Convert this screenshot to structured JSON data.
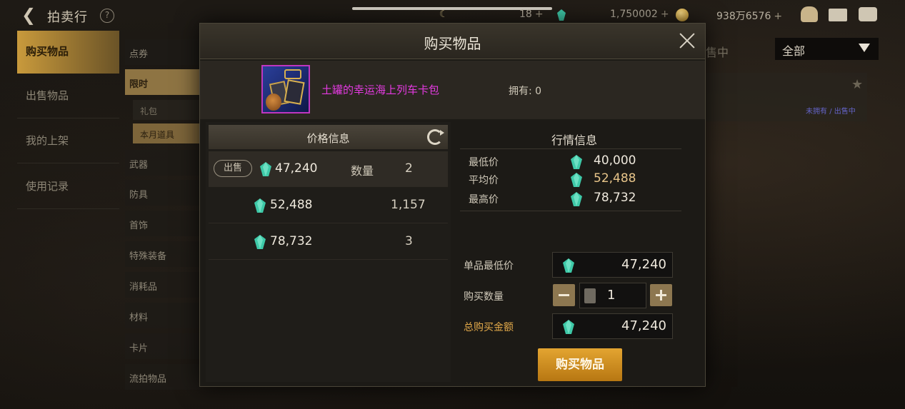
{
  "top_bar": {
    "title": "拍卖行",
    "help": "?",
    "moon": "☾",
    "currency1": "18",
    "currency2": "1,750002",
    "currency3": "938万6576",
    "plus": "+"
  },
  "nav": {
    "items": [
      {
        "label": "购买物品"
      },
      {
        "label": "出售物品"
      },
      {
        "label": "我的上架"
      },
      {
        "label": "使用记录"
      }
    ]
  },
  "categories": {
    "items": [
      {
        "label": "点券"
      },
      {
        "label": "限时"
      },
      {
        "label": "武器"
      },
      {
        "label": "防具"
      },
      {
        "label": "首饰"
      },
      {
        "label": "特殊装备"
      },
      {
        "label": "消耗品"
      },
      {
        "label": "材料"
      },
      {
        "label": "卡片"
      },
      {
        "label": "流拍物品"
      }
    ],
    "subitems": [
      {
        "label": "礼包"
      },
      {
        "label": "本月道具"
      }
    ]
  },
  "right_filter": {
    "value": "全部",
    "behind_label": "售中",
    "link_left": "未拥有",
    "link_sep": "/",
    "link_right": "出售中"
  },
  "modal": {
    "title": "购买物品",
    "item_name": "土罐的幸运海上列车卡包",
    "own_label": "拥有: 0",
    "price_info_title": "价格信息",
    "sell_tag": "出售",
    "qty_label": "数量",
    "listings": [
      {
        "price": "47,240",
        "qty": "2"
      },
      {
        "price": "52,488",
        "qty": "1,157"
      },
      {
        "price": "78,732",
        "qty": "3"
      }
    ],
    "market": {
      "title": "行情信息",
      "rows": [
        {
          "label": "最低价",
          "value": "40,000"
        },
        {
          "label": "平均价",
          "value": "52,488"
        },
        {
          "label": "最高价",
          "value": "78,732"
        }
      ]
    },
    "form": {
      "unit_price_label": "单品最低价",
      "unit_price": "47,240",
      "qty_label": "购买数量",
      "qty": "1",
      "total_label": "总购买金额",
      "total": "47,240"
    },
    "buy_button": "购买物品"
  },
  "colors": {
    "gem": "#3ec9a8",
    "accent_gold": "#e2a94a",
    "item_name": "#e33ae0"
  }
}
